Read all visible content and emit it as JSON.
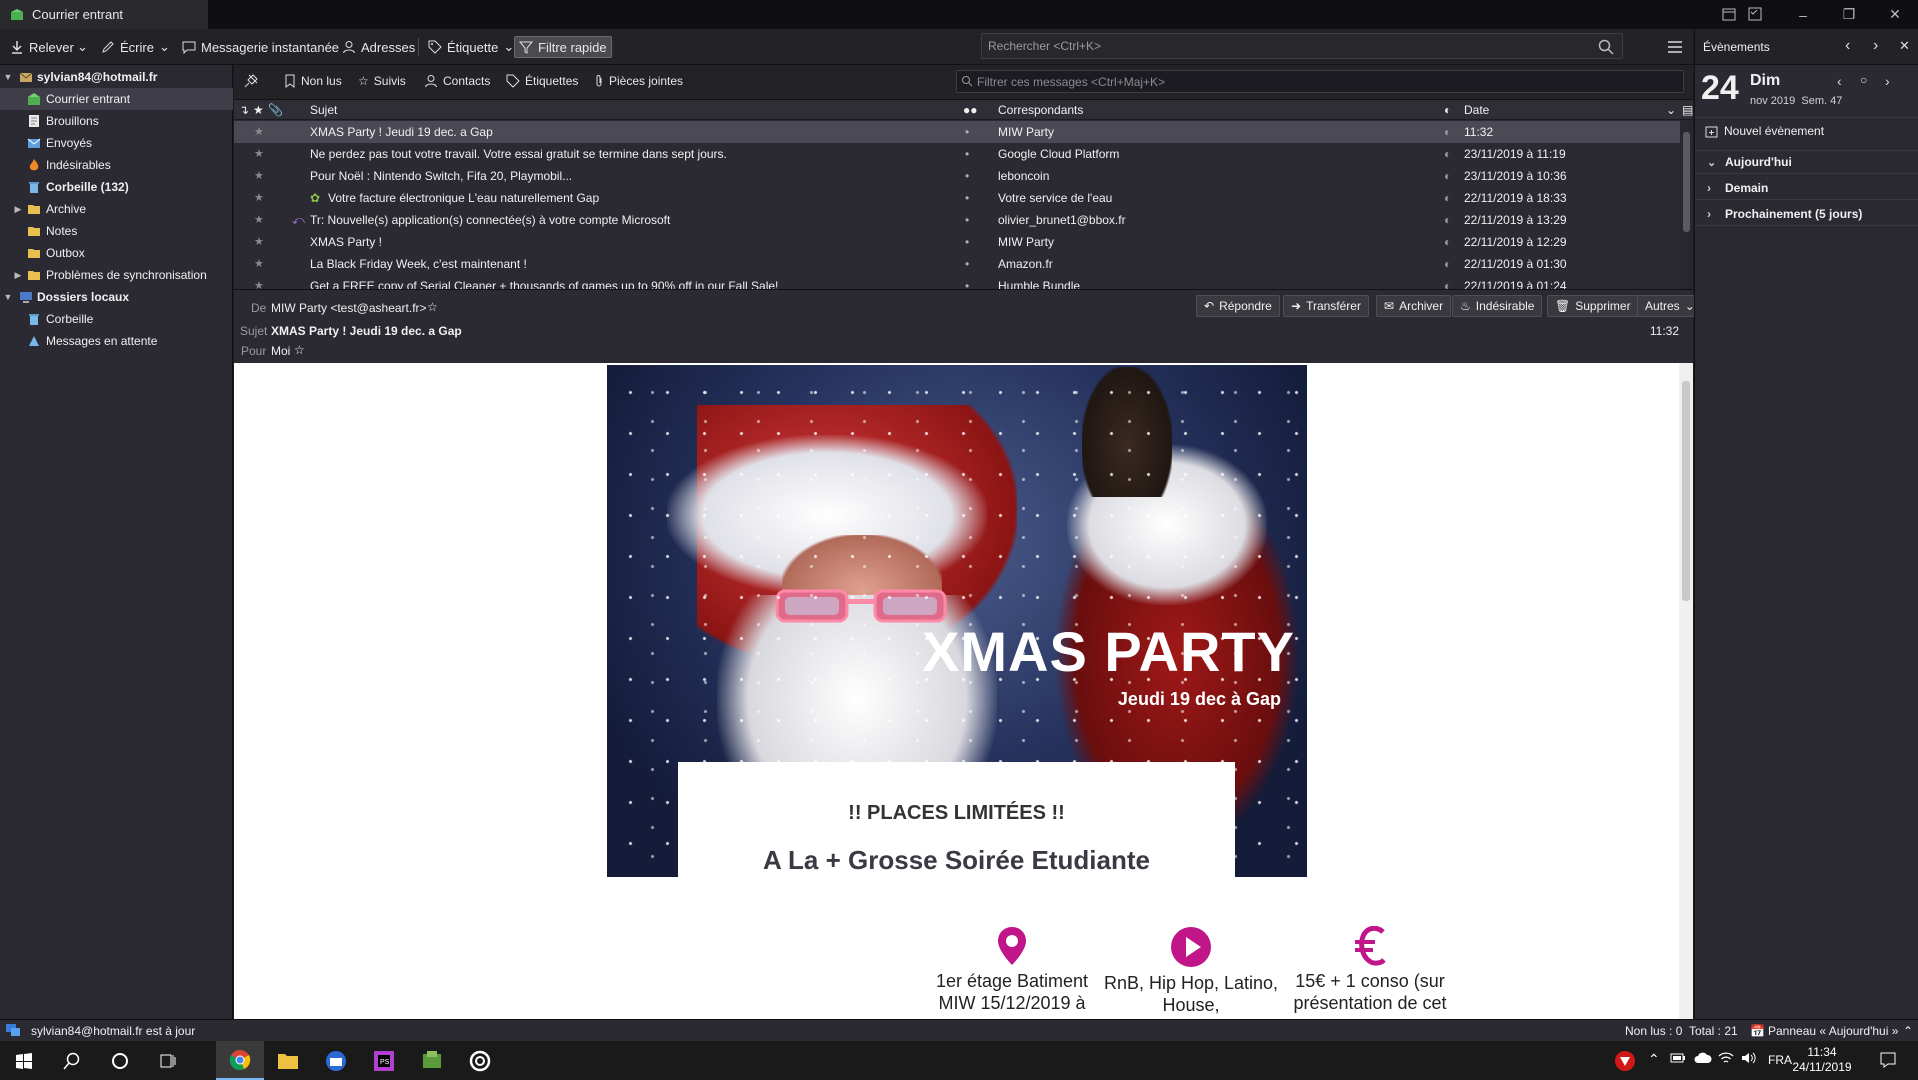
{
  "window": {
    "tab_title": "Courrier entrant"
  },
  "toolbar": {
    "get_mail": "Relever",
    "write": "Écrire",
    "chat": "Messagerie instantanée",
    "address_book": "Adresses",
    "tag": "Étiquette",
    "quick_filter": "Filtre rapide",
    "search_placeholder": "Rechercher <Ctrl+K>"
  },
  "folders": {
    "account": "sylvian84@hotmail.fr",
    "items": [
      {
        "label": "Courrier entrant",
        "selected": true
      },
      {
        "label": "Brouillons"
      },
      {
        "label": "Envoyés"
      },
      {
        "label": "Indésirables"
      },
      {
        "label": "Corbeille (132)"
      },
      {
        "label": "Archive"
      },
      {
        "label": "Notes"
      },
      {
        "label": "Outbox"
      },
      {
        "label": "Problèmes de synchronisation"
      }
    ],
    "local_account": "Dossiers locaux",
    "local_items": [
      {
        "label": "Corbeille"
      },
      {
        "label": "Messages en attente"
      }
    ]
  },
  "quickfilter": {
    "unread": "Non lus",
    "starred": "Suivis",
    "contacts": "Contacts",
    "tags": "Étiquettes",
    "attachments": "Pièces jointes",
    "filter_placeholder": "Filtrer ces messages <Ctrl+Maj+K>"
  },
  "threads": {
    "columns": {
      "subject": "Sujet",
      "correspondents": "Correspondants",
      "date": "Date"
    },
    "rows": [
      {
        "subject": "XMAS Party ! Jeudi 19 dec. a Gap",
        "from": "MIW Party",
        "date": "11:32"
      },
      {
        "subject": "Ne perdez pas tout votre travail. Votre essai gratuit se termine dans sept jours.",
        "from": "Google Cloud Platform",
        "date": "23/11/2019 à 11:19"
      },
      {
        "subject": "Pour Noël : Nintendo Switch, Fifa 20, Playmobil...",
        "from": "leboncoin",
        "date": "23/11/2019 à 10:36"
      },
      {
        "subject": "Votre facture électronique  L'eau naturellement Gap",
        "from": "Votre service de l'eau",
        "date": "22/11/2019 à 18:33"
      },
      {
        "subject": "Tr: Nouvelle(s) application(s) connectée(s) à votre compte Microsoft",
        "from": "olivier_brunet1@bbox.fr",
        "date": "22/11/2019 à 13:29"
      },
      {
        "subject": "XMAS Party !",
        "from": "MIW Party",
        "date": "22/11/2019 à 12:29"
      },
      {
        "subject": "La Black Friday Week, c'est maintenant !",
        "from": "Amazon.fr",
        "date": "22/11/2019 à 01:30"
      },
      {
        "subject": "Get a FREE copy of Serial Cleaner + thousands of games up to 90% off in our Fall Sale!",
        "from": "Humble Bundle",
        "date": "22/11/2019 à 01:24"
      }
    ]
  },
  "message": {
    "from_label": "De",
    "from": "MIW Party <test@asheart.fr>",
    "subject_label": "Sujet",
    "subject": "XMAS Party ! Jeudi 19 dec. a Gap",
    "time": "11:32",
    "to_label": "Pour",
    "to": "Moi",
    "actions": {
      "reply": "Répondre",
      "forward": "Transférer",
      "archive": "Archiver",
      "junk": "Indésirable",
      "delete": "Supprimer",
      "other": "Autres"
    }
  },
  "email": {
    "hero_title": "XMAS PARTY",
    "hero_subtitle": "Jeudi 19 dec à Gap",
    "places": "!! PLACES LIMITÉES !!",
    "tagline": "A La + Grosse Soirée Etudiante",
    "features": [
      {
        "icon": "location-pin-icon",
        "text": "1er étage Batiment MIW 15/12/2019 à"
      },
      {
        "icon": "play-icon",
        "text": "RnB, Hip Hop, Latino, House,"
      },
      {
        "icon": "euro-icon",
        "text": "15€ + 1 conso (sur présentation de cet"
      }
    ],
    "accent_color": "#c0168a"
  },
  "today": {
    "title": "Évènements",
    "day_number": "24",
    "day_name": "Dim",
    "month_week": "nov 2019  Sem. 47",
    "new_event": "Nouvel évènement",
    "sections": [
      "Aujourd'hui",
      "Demain",
      "Prochainement (5 jours)"
    ]
  },
  "status": {
    "message": "sylvian84@hotmail.fr est à jour",
    "unread": "Non lus : 0",
    "total": "Total : 21",
    "today_pane": "Panneau « Aujourd'hui »"
  },
  "taskbar": {
    "lang": "FRA",
    "time": "11:34",
    "date": "24/11/2019"
  }
}
